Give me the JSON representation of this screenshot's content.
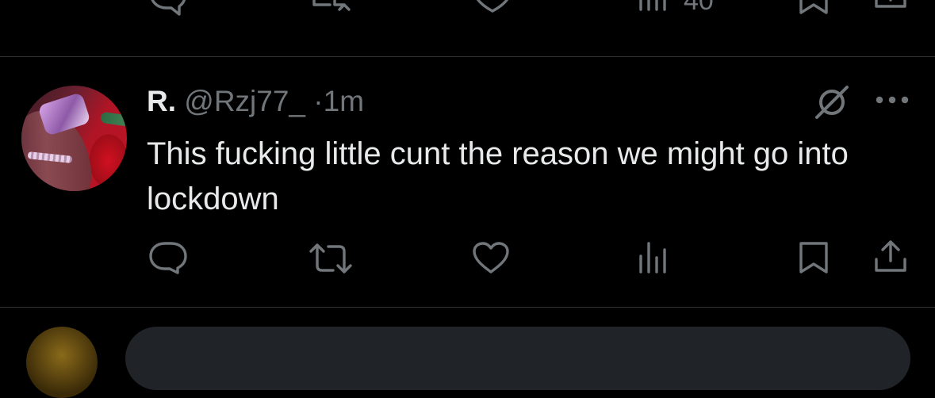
{
  "prev_tweet": {
    "actions": {
      "reply_icon": "reply-icon",
      "retweet_icon": "retweet-icon",
      "like_icon": "like-icon",
      "views_icon": "views-icon",
      "views_count": "40",
      "bookmark_icon": "bookmark-icon",
      "share_icon": "share-icon"
    }
  },
  "tweet": {
    "display_name": "R.",
    "handle": "@Rzj77_",
    "separator": "·",
    "time": "1m",
    "text": "This fucking little cunt the reason we might go into lockdown",
    "grok_icon": "grok-icon",
    "more_icon": "more-icon",
    "actions": {
      "reply_icon": "reply-icon",
      "retweet_icon": "retweet-icon",
      "like_icon": "like-icon",
      "views_icon": "views-icon",
      "bookmark_icon": "bookmark-icon",
      "share_icon": "share-icon"
    }
  },
  "colors": {
    "background": "#000000",
    "text": "#e7e9ea",
    "muted": "#71767b",
    "divider": "#2f3336"
  }
}
